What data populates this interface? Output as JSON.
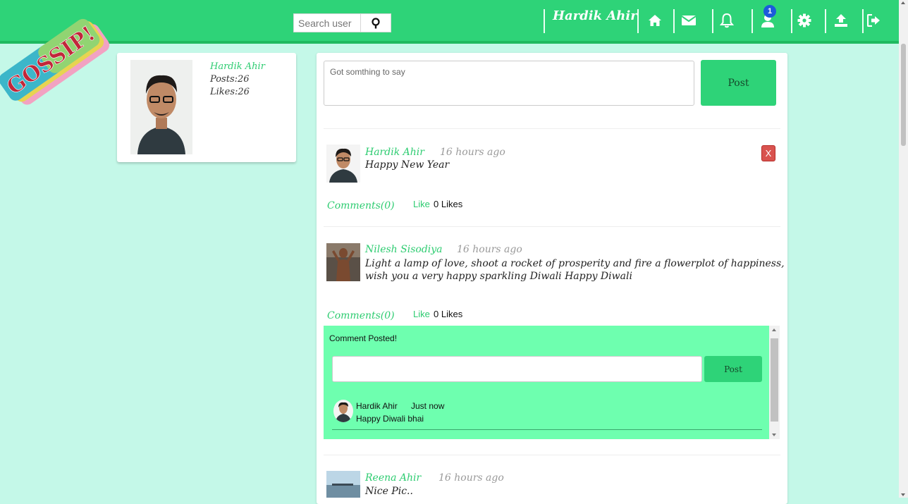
{
  "logo": {
    "text": "GOSSIP!"
  },
  "header": {
    "search": {
      "placeholder": "Search user",
      "icon": "search-icon"
    },
    "username": "Hardik Ahir",
    "nav_icons": [
      "home-icon",
      "envelope-icon",
      "bell-icon",
      "friend-requests-icon",
      "gear-icon",
      "upload-icon",
      "logout-icon"
    ],
    "notification_count": "1",
    "colors": {
      "bar": "#2ed378",
      "accent": "#2ecc71",
      "background": "#c4f8e8"
    }
  },
  "profile": {
    "name": "Hardik Ahir",
    "posts": "Posts:26",
    "likes": "Likes:26"
  },
  "composer": {
    "placeholder": "Got somthing to say",
    "post_label": "Post"
  },
  "posts": [
    {
      "author": "Hardik Ahir",
      "time": "16 hours ago",
      "text": "Happy New Year",
      "delete_label": "X",
      "comments_label": "Comments(0)",
      "like_label": "Like",
      "likes_count": "0 Likes"
    },
    {
      "author": "Nilesh Sisodiya",
      "time": "16 hours ago",
      "text_line1": "Light a lamp of love, shoot a rocket of prosperity and fire a flowerplot of happiness,",
      "text_line2": "wish you a very happy sparkling Diwali Happy Diwali",
      "comments_label": "Comments(0)",
      "like_label": "Like",
      "likes_count": "0 Likes",
      "comment_box": {
        "status": "Comment Posted!",
        "post_label": "Post",
        "comments": [
          {
            "author": "Hardik Ahir",
            "time": "Just now",
            "text": "Happy Diwali bhai"
          }
        ]
      }
    },
    {
      "author": "Reena Ahir",
      "time": "16 hours ago",
      "text": "Nice Pic.."
    }
  ]
}
